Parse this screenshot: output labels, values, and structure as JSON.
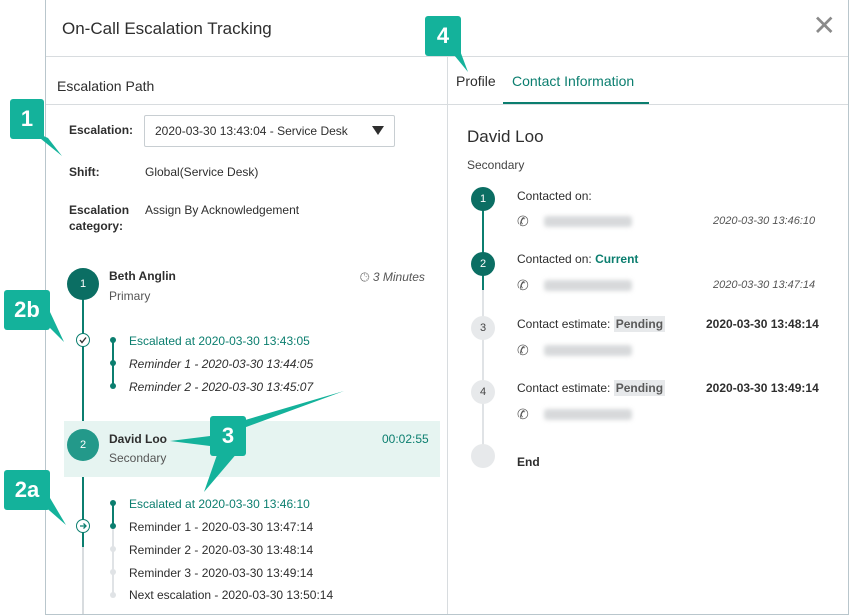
{
  "modal": {
    "title": "On-Call Escalation Tracking",
    "close_glyph": "✕"
  },
  "left": {
    "heading": "Escalation Path",
    "escalation_label": "Escalation:",
    "escalation_value": "2020-03-30 13:43:04 - Service Desk",
    "shift_label": "Shift:",
    "shift_value": "Global(Service Desk)",
    "category_label_1": "Escalation",
    "category_label_2": "category:",
    "category_value": "Assign By Acknowledgement",
    "people": [
      {
        "step": "1",
        "name": "Beth Anglin",
        "role": "Primary",
        "timer": "3 Minutes",
        "events": [
          "Escalated at 2020-03-30 13:43:05",
          "Reminder 1 - 2020-03-30 13:44:05",
          "Reminder 2 - 2020-03-30 13:45:07"
        ]
      },
      {
        "step": "2",
        "name": "David Loo",
        "role": "Secondary",
        "timer": "00:02:55",
        "events": [
          "Escalated at 2020-03-30 13:46:10",
          "Reminder 1 - 2020-03-30 13:47:14",
          "Reminder 2 - 2020-03-30 13:48:14",
          "Reminder 3 - 2020-03-30 13:49:14",
          "Next escalation - 2020-03-30 13:50:14"
        ]
      }
    ]
  },
  "right": {
    "tabs": [
      "Profile",
      "Contact Information"
    ],
    "active_tab": "Contact Information",
    "contact_name": "David Loo",
    "contact_role": "Secondary",
    "steps": [
      {
        "num": "1",
        "label": "Contacted on:",
        "status": "",
        "time": "2020-03-30 13:46:10"
      },
      {
        "num": "2",
        "label": "Contacted on:",
        "status": "Current",
        "time": "2020-03-30 13:47:14"
      },
      {
        "num": "3",
        "label": "Contact estimate:",
        "status": "Pending",
        "time": "2020-03-30 13:48:14"
      },
      {
        "num": "4",
        "label": "Contact estimate:",
        "status": "Pending",
        "time": "2020-03-30 13:49:14"
      }
    ],
    "end_label": "End"
  },
  "callouts": [
    "1",
    "2b",
    "2a",
    "3",
    "4"
  ],
  "colors": {
    "accent": "#0b7e6f",
    "callout": "#14b29b",
    "highlight": "#e6f4f1"
  }
}
